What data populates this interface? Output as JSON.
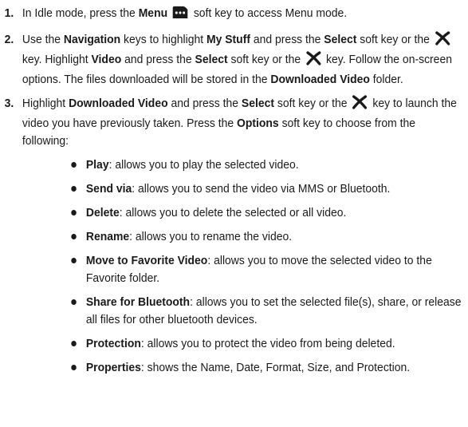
{
  "steps": [
    {
      "number": "1.",
      "parts": [
        {
          "text": "In Idle mode, press the ",
          "bold": false
        },
        {
          "text": "Menu",
          "bold": true
        },
        {
          "icon": "menu-softkey-icon"
        },
        {
          "text": " soft key to access Menu mode.",
          "bold": false
        }
      ]
    },
    {
      "number": "2.",
      "parts": [
        {
          "text": "Use the ",
          "bold": false
        },
        {
          "text": "Navigation",
          "bold": true
        },
        {
          "text": " keys to highlight ",
          "bold": false
        },
        {
          "text": "My Stuff",
          "bold": true
        },
        {
          "text": " and press the ",
          "bold": false
        },
        {
          "text": "Select",
          "bold": true
        },
        {
          "text": " soft key or the ",
          "bold": false
        },
        {
          "icon": "select-key-icon"
        },
        {
          "text": " key. Highlight ",
          "bold": false
        },
        {
          "text": "Video",
          "bold": true
        },
        {
          "text": " and press the ",
          "bold": false
        },
        {
          "text": "Select",
          "bold": true
        },
        {
          "text": " soft key or the ",
          "bold": false
        },
        {
          "icon": "select-key-icon"
        },
        {
          "text": " key. Follow the on-screen options. The files downloaded will be stored in the ",
          "bold": false
        },
        {
          "text": "Downloaded Video",
          "bold": true
        },
        {
          "text": " folder.",
          "bold": false
        }
      ]
    },
    {
      "number": "3.",
      "parts": [
        {
          "text": "Highlight ",
          "bold": false
        },
        {
          "text": "Downloaded Video",
          "bold": true
        },
        {
          "text": " and press the ",
          "bold": false
        },
        {
          "text": "Select",
          "bold": true
        },
        {
          "text": " soft key or the ",
          "bold": false
        },
        {
          "icon": "select-key-icon"
        },
        {
          "text": " key to launch the video you have previously taken. Press the ",
          "bold": false
        },
        {
          "text": "Options",
          "bold": true
        },
        {
          "text": " soft key to choose from the following:",
          "bold": false
        }
      ]
    }
  ],
  "options": [
    {
      "term": "Play",
      "desc": ": allows you to play the selected video."
    },
    {
      "term": "Send via",
      "desc": ": allows you to send the video via MMS or Bluetooth."
    },
    {
      "term": "Delete",
      "desc": ": allows you to delete the selected or all video."
    },
    {
      "term": "Rename",
      "desc": ": allows you to rename the video."
    },
    {
      "term": "Move to Favorite Video",
      "desc": ": allows you to move the selected video to the Favorite folder."
    },
    {
      "term": "Share for Bluetooth",
      "desc": ": allows you to set the selected file(s), share, or release all files for other bluetooth devices."
    },
    {
      "term": "Protection",
      "desc": ": allows you to protect the video from being deleted."
    },
    {
      "term": "Properties",
      "desc": ": shows the Name, Date, Format, Size, and Protection."
    }
  ]
}
